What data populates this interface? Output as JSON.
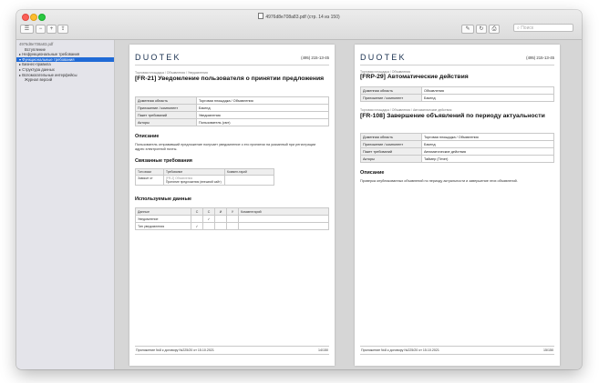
{
  "window": {
    "title": "4976d8e708a83.pdf (стр. 14 из 150)"
  },
  "toolbar": {
    "sidebar_btn": "☰",
    "zoom_out": "−",
    "zoom_in": "+",
    "share": "⇪",
    "markup": "✎",
    "rotate": "↻",
    "search_placeholder": "Поиск"
  },
  "sidebar": {
    "root": "4976d8e708a83.pdf",
    "items": [
      {
        "label": "Вступление",
        "level": 2,
        "selected": false
      },
      {
        "label": "▸ Нефункциональные требования",
        "level": 1,
        "selected": false
      },
      {
        "label": "▾ Функциональные требования",
        "level": 1,
        "selected": true
      },
      {
        "label": "▸ Бизнес-правила",
        "level": 1,
        "selected": false
      },
      {
        "label": "▸ Структура данных",
        "level": 1,
        "selected": false
      },
      {
        "label": "▸ Вспомогательные интерфейсы",
        "level": 1,
        "selected": false
      },
      {
        "label": "Журнал версий",
        "level": 2,
        "selected": false
      }
    ]
  },
  "page1": {
    "logo": "DUOTEK",
    "phone": "(495) 215-13-45",
    "breadcrumb": "Торговая площадка / Объявления / Уведомления",
    "title": "[FR-21] Уведомление пользователя о принятии предложения",
    "attributes": [
      {
        "key": "Доменная область",
        "value": "Торговая площадка / Объявления"
      },
      {
        "key": "Приложение / компонент",
        "value": "Бэкенд"
      },
      {
        "key": "Пакет требований",
        "value": "Уведомления"
      },
      {
        "key": "Акторы",
        "value": "Пользователь (смт)"
      }
    ],
    "desc_heading": "Описание",
    "desc_text": "Пользователь отправивший предложение получает уведомление о его принятии на указанный при регистрации адрес электронной почты.",
    "related_heading": "Связанные требования",
    "related_headers": [
      "Тип связи",
      "Требование",
      "Коммен-тарий"
    ],
    "related_rows": [
      {
        "type": "Зависит от",
        "req_code": "[FR-2] Объявления",
        "req_name": "Принятие предложения (внешний сайт)",
        "comment": ""
      }
    ],
    "data_heading": "Используемые данные",
    "data_headers": [
      "Данные",
      "С",
      "С",
      "И",
      "У",
      "Комментарий"
    ],
    "data_rows": [
      {
        "name": "Уведомление",
        "marks": [
          "",
          "✓",
          "",
          ""
        ],
        "comment": ""
      },
      {
        "name": "Тип уведомления",
        "marks": [
          "✓",
          "",
          "",
          ""
        ],
        "comment": ""
      }
    ],
    "footer_left": "Приложение №8 к договору №225/20 от 15.10.2021",
    "footer_right": "14/150"
  },
  "page2": {
    "logo": "DUOTEK",
    "phone": "(495) 215-13-45",
    "breadcrumb1": "Торговая площадка / Объявления",
    "title1": "[FRP-29] Автоматические действия",
    "attributes1": [
      {
        "key": "Доменная область",
        "value": "Объявления"
      },
      {
        "key": "Приложение / компонент",
        "value": "Бэкенд"
      }
    ],
    "breadcrumb2": "Торговая площадка / Объявления / Автоматические действия",
    "title2": "[FR-108] Завершение объявлений по периоду актуальности",
    "attributes2": [
      {
        "key": "Доменная область",
        "value": "Торговая площадка / Объявления"
      },
      {
        "key": "Приложение / компонент",
        "value": "Бэкенд"
      },
      {
        "key": "Пакет требований",
        "value": "Автоматические действия"
      },
      {
        "key": "Акторы",
        "value": "Таймер (Timer)"
      }
    ],
    "desc_heading": "Описание",
    "desc_text": "Проверка опубликованных объявлений по периоду актуальности и завершение этих объявлений.",
    "footer_left": "Приложение №8 к договору №225/20 от 15.10.2021",
    "footer_right": "15/150"
  }
}
